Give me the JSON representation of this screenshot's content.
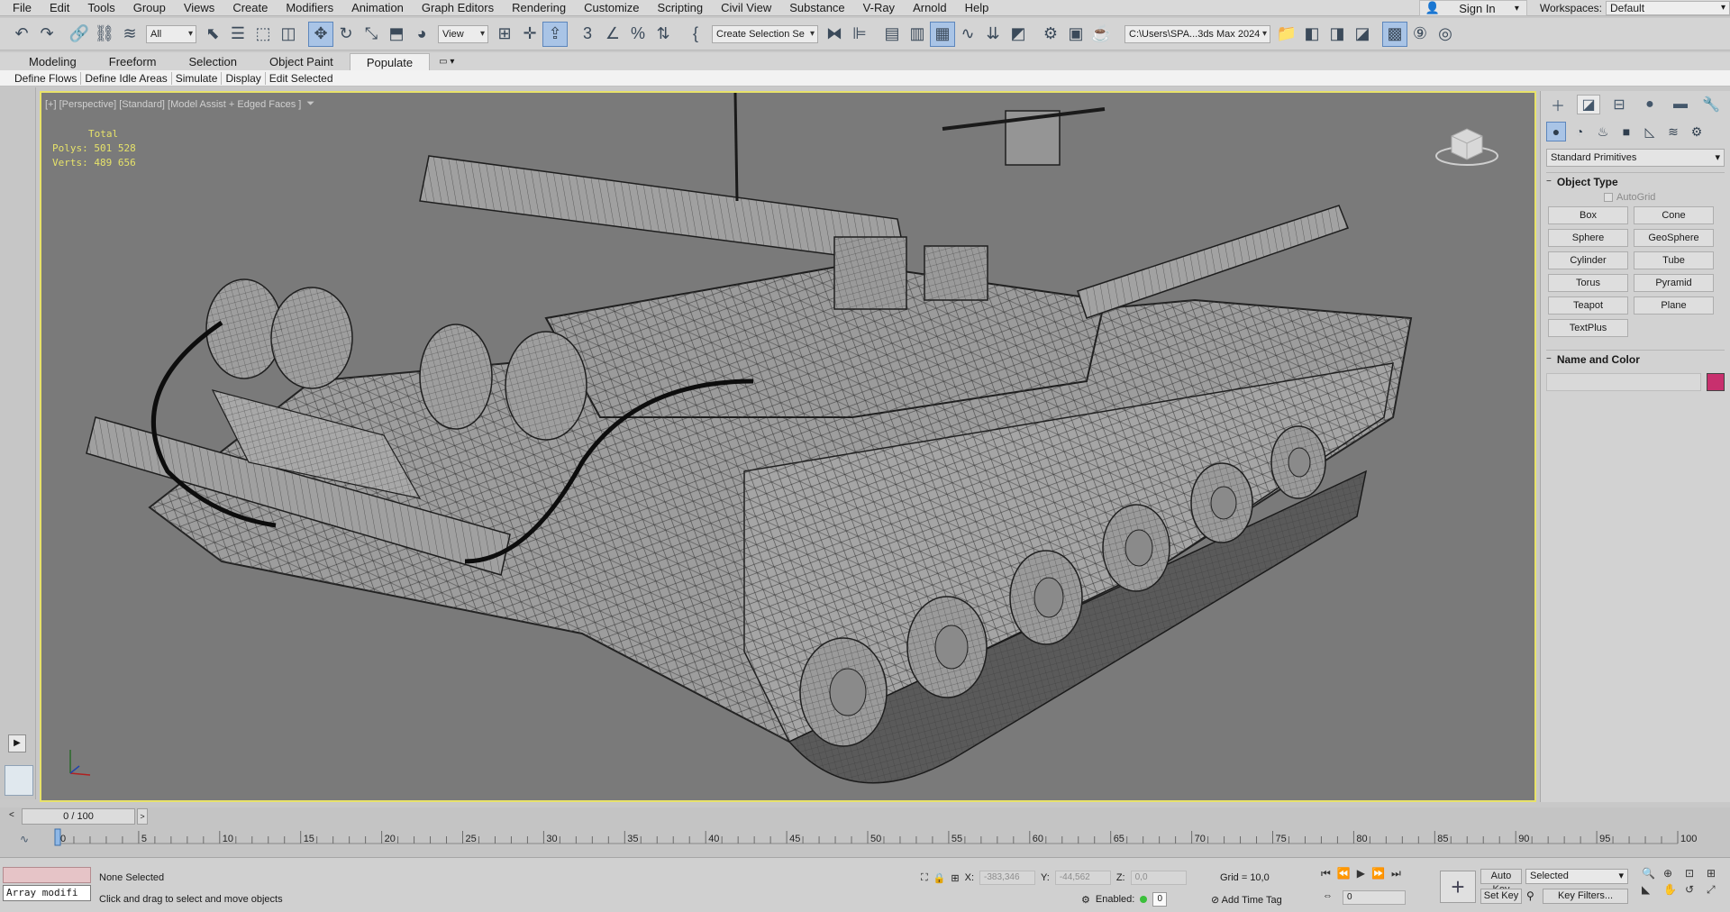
{
  "menu": [
    "File",
    "Edit",
    "Tools",
    "Group",
    "Views",
    "Create",
    "Modifiers",
    "Animation",
    "Graph Editors",
    "Rendering",
    "Customize",
    "Scripting",
    "Civil View",
    "Substance",
    "V-Ray",
    "Arnold",
    "Help"
  ],
  "signin": {
    "label": "Sign In"
  },
  "workspace": {
    "label": "Workspaces:",
    "value": "Default"
  },
  "toolbar": {
    "filter": "All",
    "refcoord": "View",
    "selection_set": "Create Selection Se",
    "project_path": "C:\\Users\\SPA...3ds Max 2024"
  },
  "ribbon_tabs": [
    "Modeling",
    "Freeform",
    "Selection",
    "Object Paint",
    "Populate"
  ],
  "ribbon_active": "Populate",
  "sub_ribbon": [
    "Define Flows",
    "Define Idle Areas",
    "Simulate",
    "Display",
    "Edit Selected"
  ],
  "viewport": {
    "label": "[+] [Perspective] [Standard] [Model Assist + Edged Faces ]",
    "stats": {
      "title": "Total",
      "polys_label": "Polys:",
      "polys": "501 528",
      "verts_label": "Verts:",
      "verts": "489 656"
    },
    "border_color": "#e8e26a"
  },
  "command_panel": {
    "dropdown": "Standard Primitives",
    "object_type_title": "Object Type",
    "autogrid": "AutoGrid",
    "primitives": [
      "Box",
      "Cone",
      "Sphere",
      "GeoSphere",
      "Cylinder",
      "Tube",
      "Torus",
      "Pyramid",
      "Teapot",
      "Plane",
      "TextPlus"
    ],
    "name_color_title": "Name and Color",
    "swatch_color": "#c8306e"
  },
  "timeline": {
    "frame_display": "0 / 100",
    "ruler_labels": [
      "0",
      "5",
      "10",
      "15",
      "20",
      "25",
      "30",
      "35",
      "40",
      "45",
      "50",
      "55",
      "60",
      "65",
      "70",
      "75",
      "80",
      "85",
      "90",
      "95",
      "100"
    ]
  },
  "status": {
    "listener_text": "Array modifi",
    "selection": "None Selected",
    "prompt": "Click and drag to select and move objects",
    "x_label": "X:",
    "x": "-383,346",
    "y_label": "Y:",
    "y": "-44,562",
    "z_label": "Z:",
    "z": "0,0",
    "grid": "Grid = 10,0",
    "enabled_label": "Enabled:",
    "enabled_value": "0",
    "add_time_tag": "Add Time Tag",
    "frame": "0",
    "auto_key": "Auto Key",
    "set_key": "Set Key",
    "key_mode": "Selected",
    "key_filters": "Key Filters..."
  }
}
